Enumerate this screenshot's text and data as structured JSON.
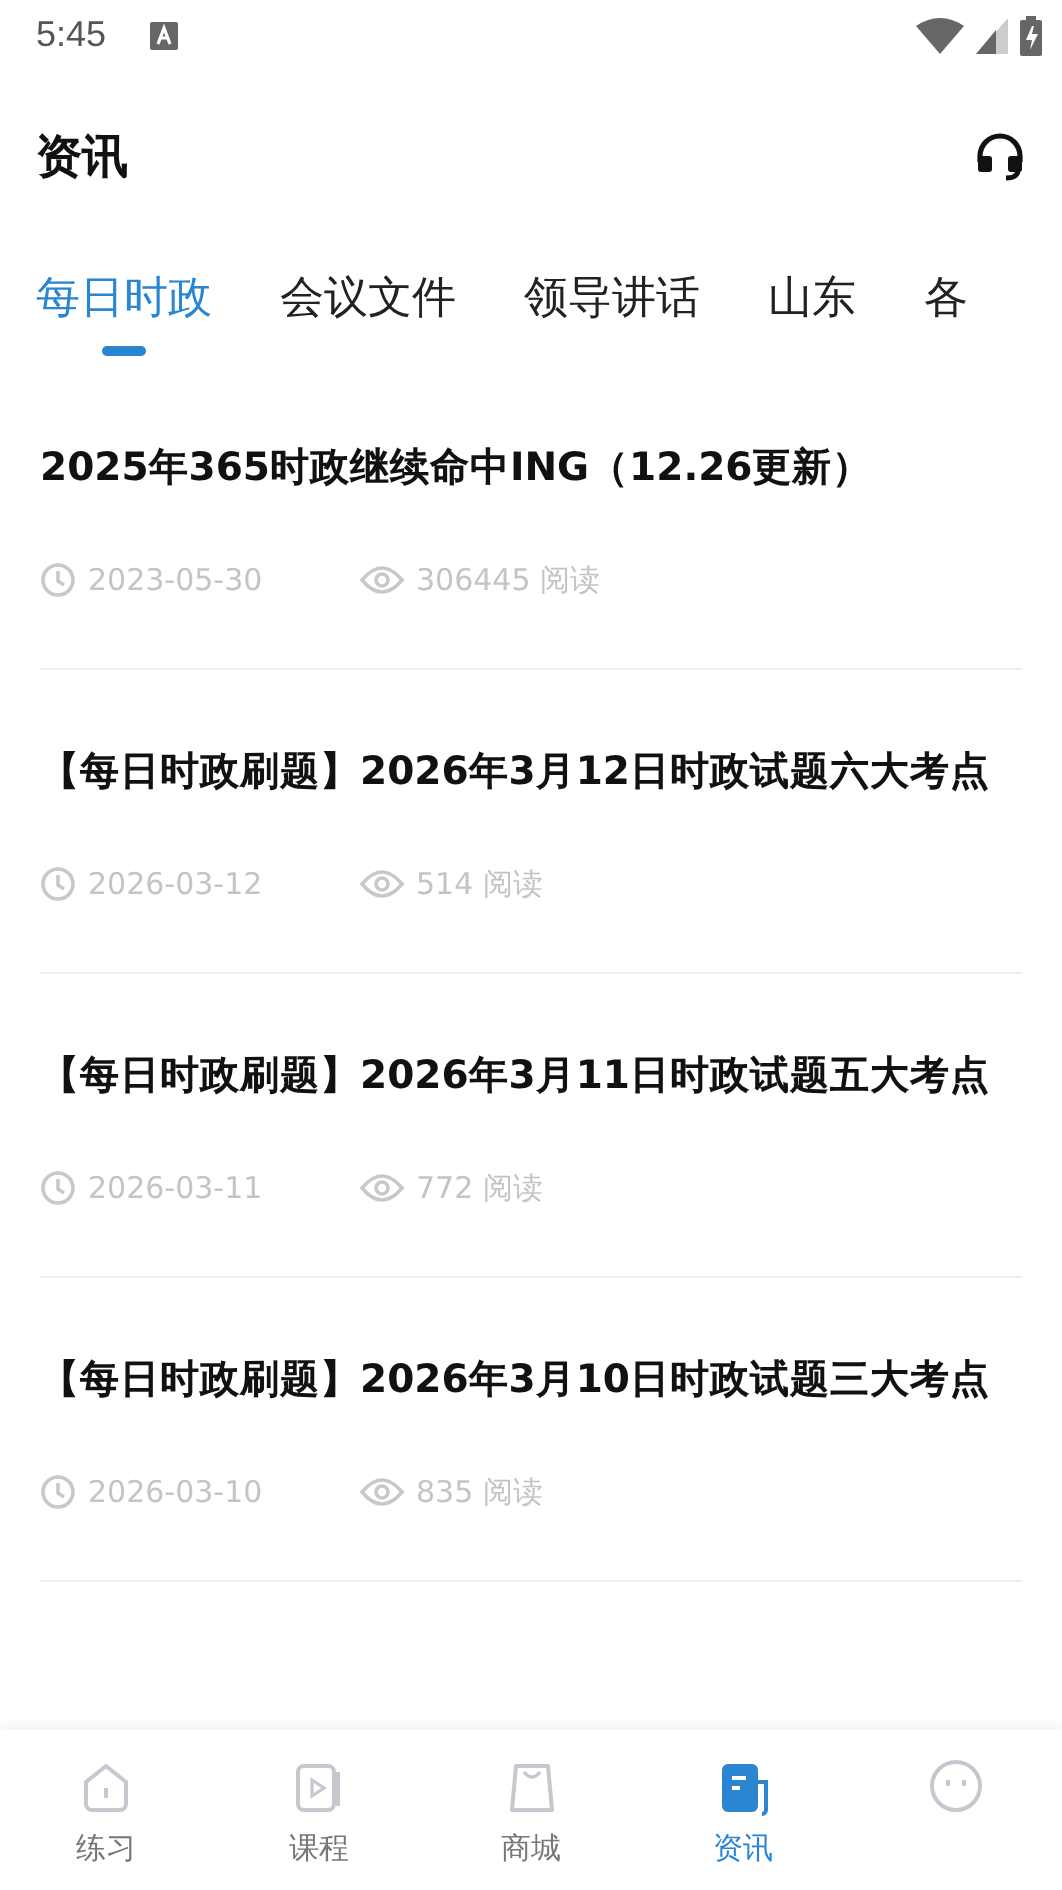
{
  "status_bar": {
    "time": "5:45"
  },
  "header": {
    "title": "资讯"
  },
  "tabs": [
    {
      "label": "每日时政",
      "selected": true
    },
    {
      "label": "会议文件",
      "selected": false
    },
    {
      "label": "领导讲话",
      "selected": false
    },
    {
      "label": "山东",
      "selected": false
    },
    {
      "label": "各",
      "selected": false
    }
  ],
  "articles": [
    {
      "title": "2025年365时政继续命中ING（12.26更新）",
      "date": "2023-05-30",
      "reads": "306445 阅读"
    },
    {
      "title": "【每日时政刷题】2026年3月12日时政试题六大考点",
      "date": "2026-03-12",
      "reads": "514 阅读"
    },
    {
      "title": "【每日时政刷题】2026年3月11日时政试题五大考点",
      "date": "2026-03-11",
      "reads": "772 阅读"
    },
    {
      "title": "【每日时政刷题】2026年3月10日时政试题三大考点",
      "date": "2026-03-10",
      "reads": "835 阅读"
    }
  ],
  "bottom_nav": [
    {
      "kind": "home",
      "label": "练习",
      "selected": false
    },
    {
      "kind": "video",
      "label": "课程",
      "selected": false
    },
    {
      "kind": "bag",
      "label": "商城",
      "selected": false
    },
    {
      "kind": "news",
      "label": "资讯",
      "selected": true
    },
    {
      "kind": "face",
      "selected": false
    }
  ]
}
